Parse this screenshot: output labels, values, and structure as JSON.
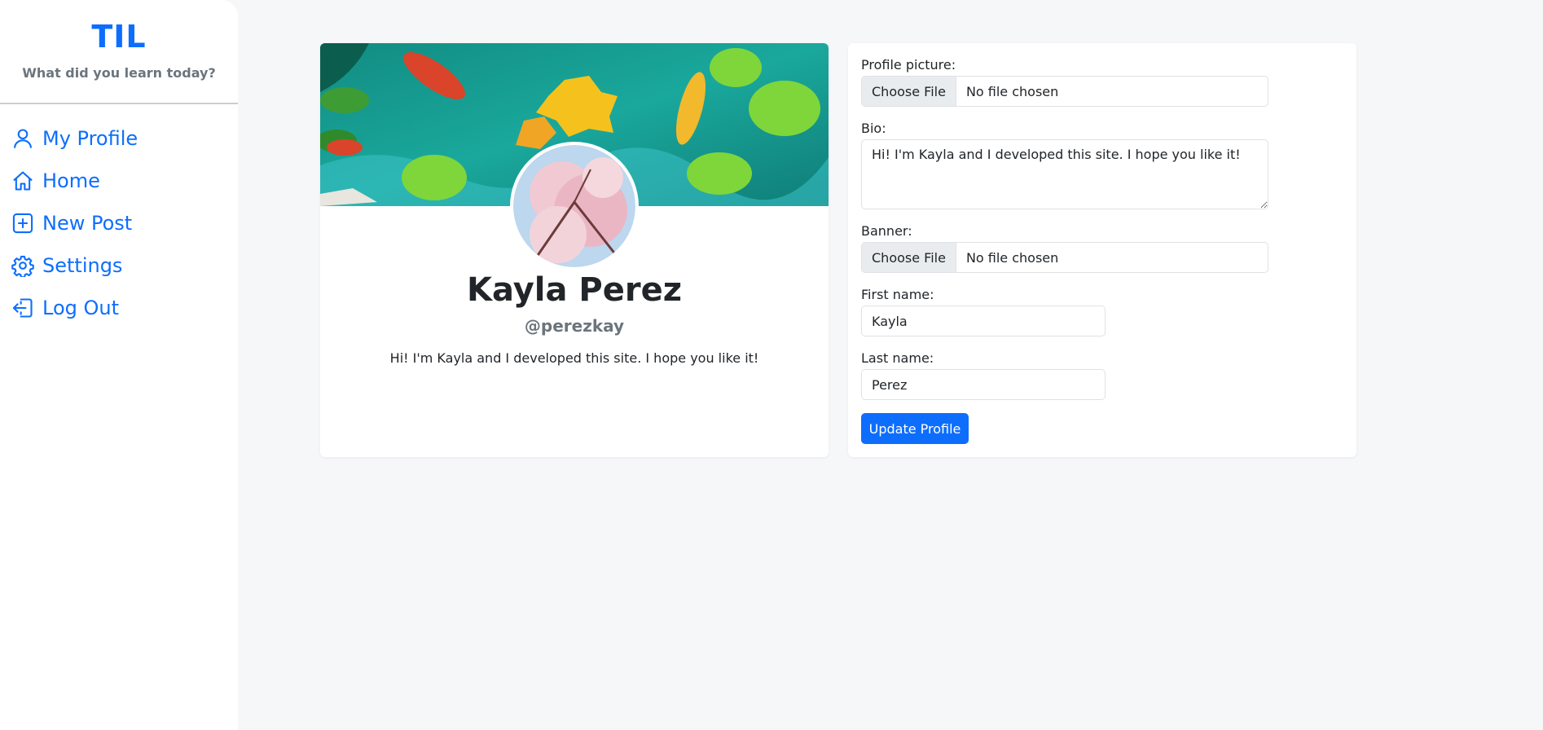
{
  "sidebar": {
    "brand_title": "TIL",
    "brand_tagline": "What did you learn today?",
    "items": [
      {
        "label": "My Profile",
        "icon": "user-icon"
      },
      {
        "label": "Home",
        "icon": "home-icon"
      },
      {
        "label": "New Post",
        "icon": "plus-square-icon"
      },
      {
        "label": "Settings",
        "icon": "gear-icon"
      },
      {
        "label": "Log Out",
        "icon": "logout-icon"
      }
    ]
  },
  "profile": {
    "full_name": "Kayla Perez",
    "handle": "@perezkay",
    "bio": "Hi! I'm Kayla and I developed this site. I hope you like it!"
  },
  "form": {
    "profile_picture_label": "Profile picture:",
    "choose_file_label": "Choose File",
    "no_file_text": "No file chosen",
    "bio_label": "Bio:",
    "bio_value": "Hi! I'm Kayla and I developed this site. I hope you like it!",
    "banner_label": "Banner:",
    "first_name_label": "First name:",
    "first_name_value": "Kayla",
    "last_name_label": "Last name:",
    "last_name_value": "Perez",
    "submit_label": "Update Profile"
  },
  "colors": {
    "accent": "#0d6efd",
    "background": "#f6f7f9",
    "muted": "#6c757d"
  }
}
